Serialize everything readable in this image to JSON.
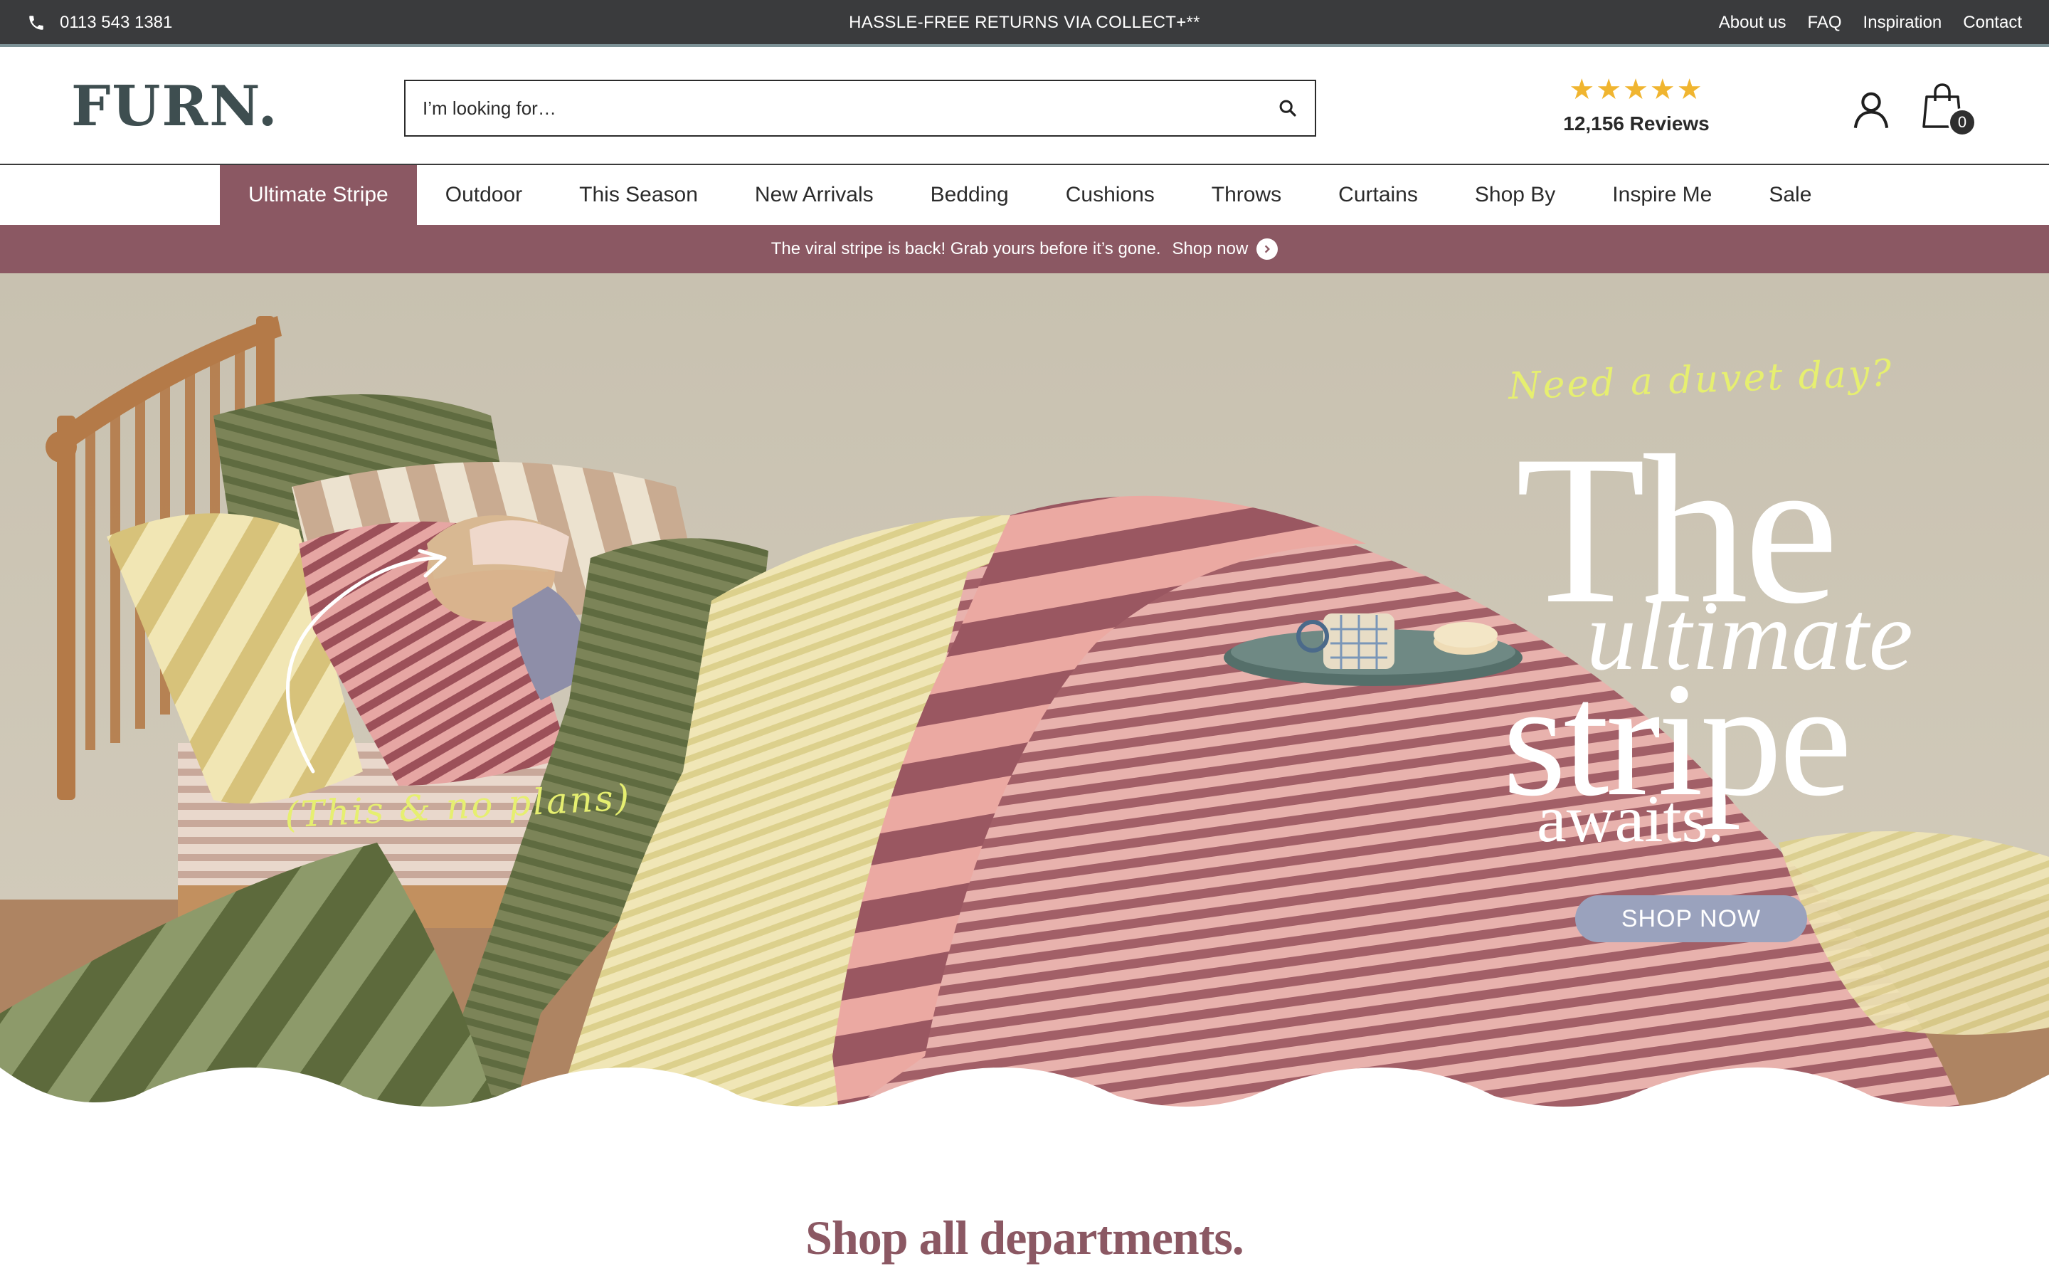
{
  "topbar": {
    "phone": "0113 543 1381",
    "promo": "HASSLE-FREE RETURNS VIA COLLECT+**",
    "links": [
      "About us",
      "FAQ",
      "Inspiration",
      "Contact"
    ]
  },
  "header": {
    "logo": "FURN.",
    "search_placeholder": "I’m looking for…",
    "rating_stars": 5,
    "reviews_count": "12,156 Reviews",
    "bag_count": "0"
  },
  "nav": {
    "items": [
      "Ultimate Stripe",
      "Outdoor",
      "This Season",
      "New Arrivals",
      "Bedding",
      "Cushions",
      "Throws",
      "Curtains",
      "Shop By",
      "Inspire Me",
      "Sale"
    ],
    "active": "Ultimate Stripe"
  },
  "announcement": {
    "text": "The viral stripe is back! Grab yours before it’s gone.",
    "link": "Shop now"
  },
  "hero": {
    "tagline": "Need a duvet day?",
    "note": "(This & no plans)",
    "title_the": "The",
    "title_ultimate": "ultimate",
    "title_stripe": "stripe",
    "title_awaits": "awaits.",
    "cta": "SHOP NOW"
  },
  "section": {
    "title": "Shop all departments."
  },
  "colors": {
    "topbar_bg": "#3a3b3d",
    "accent_plum": "#8b5863",
    "logo": "#3e4e50",
    "stars": "#f0b530",
    "handwriting": "#e6ef70",
    "cta_bg": "#9aa2bd"
  },
  "icons": [
    "phone-icon",
    "search-icon",
    "star-icon",
    "account-icon",
    "shopping-bag-icon",
    "chevron-right-icon"
  ]
}
